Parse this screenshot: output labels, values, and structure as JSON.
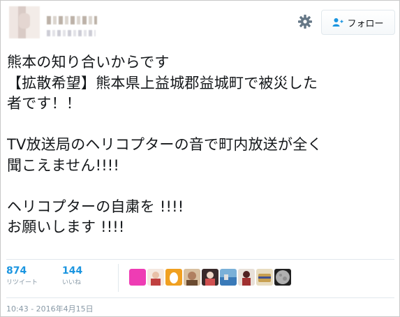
{
  "header": {
    "follow_label": "フォロー"
  },
  "tweet": {
    "lines": [
      "熊本の知り合いからです",
      "【拡散希望】熊本県上益城郡益城町で被災した",
      "者です！！",
      "",
      "TV放送局のヘリコプターの音で町内放送が全く",
      "聞こえません!!!!",
      "",
      "ヘリコプターの自粛を  !!!!",
      "お願いします    !!!!"
    ]
  },
  "stats": {
    "retweets": {
      "count": "874",
      "label": "リツイート"
    },
    "likes": {
      "count": "144",
      "label": "いいね"
    }
  },
  "likers": [
    {
      "icon": "pink-square-avatar",
      "color": "#ee3cb4"
    },
    {
      "icon": "person-avatar",
      "color": "#e8c0a8"
    },
    {
      "icon": "egg-avatar",
      "color": "#f0a020"
    },
    {
      "icon": "character-avatar",
      "color": "#b08060"
    },
    {
      "icon": "kimono-avatar",
      "color": "#d05050"
    },
    {
      "icon": "landscape-avatar",
      "color": "#3a7ab8"
    },
    {
      "icon": "dark-figure-avatar",
      "color": "#502020"
    },
    {
      "icon": "bag-avatar",
      "color": "#c8a050"
    },
    {
      "icon": "moon-avatar",
      "color": "#808080"
    }
  ],
  "timestamp": "10:43 - 2016年4月15日",
  "colors": {
    "accent": "#1b95e0",
    "muted": "#8899a6",
    "text": "#14171a"
  }
}
